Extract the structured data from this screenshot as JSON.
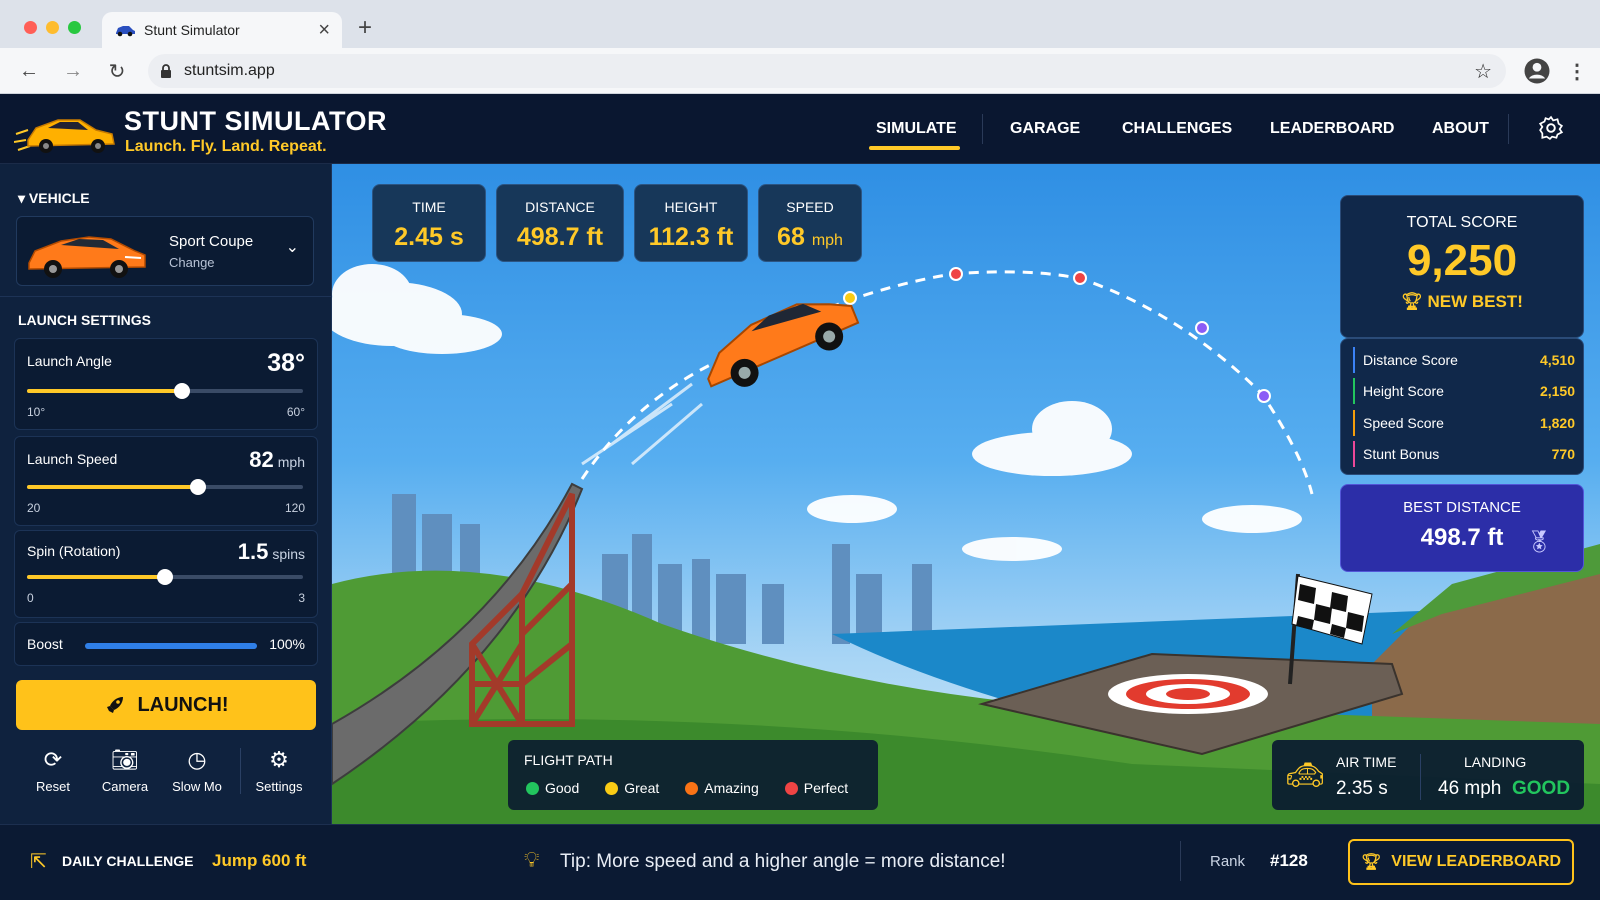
{
  "browser": {
    "tab_title": "Stunt Simulator",
    "url": "stuntsim.app",
    "icons": [
      "car-favicon-icon",
      "close-icon",
      "plus-icon",
      "back-icon",
      "forward-icon",
      "reload-icon",
      "lock-icon",
      "star-icon",
      "profile-icon",
      "menu-icon"
    ]
  },
  "header": {
    "title": "STUNT SIMULATOR",
    "subtitle": "Launch. Fly. Land. Repeat.",
    "nav": [
      "SIMULATE",
      "GARAGE",
      "CHALLENGES",
      "LEADERBOARD",
      "ABOUT"
    ],
    "active_nav": "SIMULATE"
  },
  "vehicle": {
    "section": "VEHICLE",
    "name": "Sport Coupe",
    "change": "Change"
  },
  "launch": {
    "section": "LAUNCH SETTINGS",
    "angle": {
      "label": "Launch Angle",
      "value": "38°",
      "min": "10°",
      "max": "60°",
      "fraction": 0.56
    },
    "speed": {
      "label": "Launch Speed",
      "value": "82",
      "unit": "mph",
      "min": "20",
      "max": "120",
      "fraction": 0.62
    },
    "spin": {
      "label": "Spin (Rotation)",
      "value": "1.5",
      "unit": "spins",
      "min": "0",
      "max": "3",
      "fraction": 0.5
    },
    "boost": {
      "label": "Boost",
      "value": "100%",
      "fraction": 1.0
    },
    "launch_button": "LAUNCH!"
  },
  "controls": [
    "Reset",
    "Camera",
    "Slow Mo",
    "Settings"
  ],
  "stats": [
    {
      "label": "TIME",
      "value": "2.45",
      "unit": "s"
    },
    {
      "label": "DISTANCE",
      "value": "498.7",
      "unit": "ft"
    },
    {
      "label": "HEIGHT",
      "value": "112.3",
      "unit": "ft"
    },
    {
      "label": "SPEED",
      "value": "68",
      "unit": "mph"
    }
  ],
  "score": {
    "label": "TOTAL SCORE",
    "value": "9,250",
    "badge": "NEW BEST!",
    "breakdown": [
      {
        "label": "Distance Score",
        "value": "4,510",
        "color": "#3b82f6"
      },
      {
        "label": "Height Score",
        "value": "2,150",
        "color": "#22c55e"
      },
      {
        "label": "Speed Score",
        "value": "1,820",
        "color": "#f59e0b"
      },
      {
        "label": "Stunt Bonus",
        "value": "770",
        "color": "#ec4899"
      }
    ]
  },
  "best_distance": {
    "label": "BEST DISTANCE",
    "value": "498.7 ft"
  },
  "flight_path": {
    "title": "FLIGHT PATH",
    "items": [
      {
        "label": "Good",
        "color": "#22c55e"
      },
      {
        "label": "Great",
        "color": "#facc15"
      },
      {
        "label": "Amazing",
        "color": "#f97316"
      },
      {
        "label": "Perfect",
        "color": "#ef4444"
      }
    ]
  },
  "landing": {
    "air_time_label": "AIR TIME",
    "air_time": "2.35 s",
    "landing_label": "LANDING",
    "landing_speed": "46 mph",
    "landing_rating": "GOOD"
  },
  "footer": {
    "daily_label": "DAILY CHALLENGE",
    "daily_value": "Jump 600 ft",
    "tip": "Tip: More speed and a higher angle = more distance!",
    "rank_label": "Rank",
    "rank_value": "#128",
    "leaderboard_button": "VIEW LEADERBOARD"
  },
  "colors": {
    "accent": "#ffc928",
    "panel": "#0f223e",
    "boost": "#2f7fe8"
  }
}
